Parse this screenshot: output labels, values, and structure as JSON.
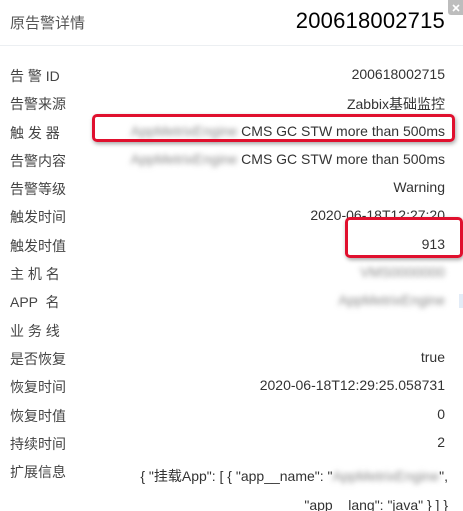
{
  "header": {
    "title": "原告警详情",
    "big_id": "200618002715",
    "close_icon": "close-icon"
  },
  "rows": [
    {
      "key": "id",
      "label": "告 警 ID",
      "value": "200618002715"
    },
    {
      "key": "source",
      "label": "告警来源",
      "value": "Zabbix基础监控"
    },
    {
      "key": "trigger",
      "label": "触 发 器",
      "value_hidden": "AppMetrixEngine",
      "value": "CMS GC STW more than 500ms"
    },
    {
      "key": "content",
      "label": "告警内容",
      "value_hidden": "AppMetrixEngine",
      "value": "CMS GC STW more than 500ms"
    },
    {
      "key": "level",
      "label": "告警等级",
      "value": "Warning"
    },
    {
      "key": "trigger_time",
      "label": "触发时间",
      "value": "2020-06-18T12:27:20"
    },
    {
      "key": "trigger_value",
      "label": "触发时值",
      "value": "913"
    },
    {
      "key": "host",
      "label": "主 机 名",
      "value_hidden": "VMS0000000"
    },
    {
      "key": "app",
      "label": "APP  名",
      "value_hidden": "AppMetrixEngine"
    },
    {
      "key": "business",
      "label": "业 务 线",
      "value": ""
    },
    {
      "key": "recovered",
      "label": "是否恢复",
      "value": "true"
    },
    {
      "key": "recover_time",
      "label": "恢复时间",
      "value": "2020-06-18T12:29:25.058731"
    },
    {
      "key": "recover_value",
      "label": "恢复时值",
      "value": "0"
    },
    {
      "key": "duration",
      "label": "持续时间",
      "value": "2"
    }
  ],
  "extend": {
    "label": "扩展信息",
    "line1_prefix": "{ \"挂载App\": [ { \"app__name\": \"",
    "line1_hidden": "AppMetrixEngine",
    "line1_suffix": "\",",
    "line2": "\"app__lang\": \"java\" } ] }"
  }
}
